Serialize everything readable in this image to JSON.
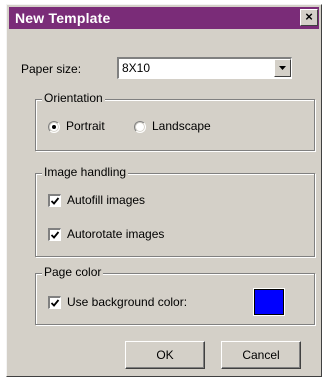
{
  "window": {
    "title": "New Template",
    "close_label": "×",
    "title_bar_color": "#7a2c78"
  },
  "paper_size": {
    "label": "Paper size:",
    "value": "8X10"
  },
  "orientation": {
    "group_label": "Orientation",
    "options": [
      {
        "label": "Portrait",
        "selected": true
      },
      {
        "label": "Landscape",
        "selected": false
      }
    ]
  },
  "image_handling": {
    "group_label": "Image handling",
    "autofill": {
      "label": "Autofill images",
      "checked": true
    },
    "autorotate": {
      "label": "Autorotate images",
      "checked": true
    }
  },
  "page_color": {
    "group_label": "Page color",
    "use_background": {
      "label": "Use background color:",
      "checked": true
    },
    "swatch_color": "#0000ff"
  },
  "buttons": {
    "ok": "OK",
    "cancel": "Cancel"
  }
}
